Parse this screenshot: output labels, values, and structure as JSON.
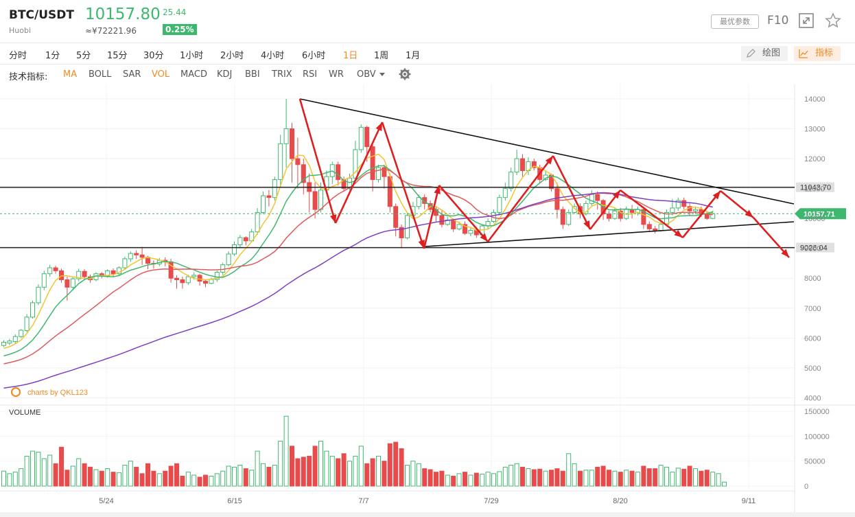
{
  "header": {
    "pair": "BTC/USDT",
    "exchange": "Huobi",
    "price": "10157.80",
    "change": "25.44",
    "cny": "≈¥72221.96",
    "change_pct": "0.25%",
    "best_params": "最优参数",
    "f10": "F10",
    "expand_icon": "expand-icon",
    "star_icon": "star-icon"
  },
  "periods": [
    "分时",
    "1分",
    "5分",
    "15分",
    "30分",
    "1小时",
    "2小时",
    "4小时",
    "6小时",
    "1日",
    "1周",
    "1月"
  ],
  "active_period": "1日",
  "tools": {
    "draw": "绘图",
    "indicator": "指标"
  },
  "indicators": {
    "label": "技术指标:",
    "items": [
      "MA",
      "BOLL",
      "SAR",
      "VOL",
      "MACD",
      "KDJ",
      "BBI",
      "TRIX",
      "RSI",
      "WR",
      "OBV"
    ],
    "active": [
      "MA",
      "VOL"
    ]
  },
  "watermark": "charts by QKL123",
  "volume_label": "VOLUME",
  "colors": {
    "up": "#3fb86f",
    "down": "#e84b4b",
    "accent": "#f08a24",
    "ma5": "#f4c430",
    "ma10": "#3fb86f",
    "ma20": "#e05a5a",
    "ma60": "#7b3fc4"
  },
  "chart_data": {
    "type": "candlestick",
    "x_ticks": [
      "5/24",
      "6/15",
      "7/7",
      "7/29",
      "8/20",
      "9/11"
    ],
    "price_ticks": [
      14000,
      13000,
      12000,
      11000,
      10000,
      9000,
      8000,
      7000,
      6000,
      5000,
      4000
    ],
    "volume_ticks": [
      150000,
      100000,
      50000,
      0
    ],
    "ylim": [
      4000,
      14000
    ],
    "labels": {
      "resistance": "11043.70",
      "current": "10157.71",
      "support": "9026.04"
    },
    "levels": {
      "resistance": 11043.7,
      "current": 10157.71,
      "support": 9026.04
    },
    "candles": [
      [
        5750,
        5860,
        5700,
        5930
      ],
      [
        5830,
        5900,
        5760,
        5970
      ],
      [
        5880,
        6050,
        5820,
        6120
      ],
      [
        6050,
        6260,
        6000,
        6300
      ],
      [
        6250,
        6700,
        6200,
        6800
      ],
      [
        6700,
        7180,
        6650,
        7250
      ],
      [
        7180,
        7700,
        7100,
        7800
      ],
      [
        7700,
        8150,
        7600,
        8250
      ],
      [
        8150,
        8350,
        8050,
        8450
      ],
      [
        8350,
        8250,
        8150,
        8420
      ],
      [
        8250,
        7950,
        7850,
        8320
      ],
      [
        7950,
        7700,
        7250,
        8050
      ],
      [
        7700,
        7980,
        7600,
        8060
      ],
      [
        7980,
        8230,
        7900,
        8320
      ],
      [
        8230,
        8050,
        7950,
        8300
      ],
      [
        8050,
        7950,
        7850,
        8130
      ],
      [
        7950,
        8150,
        7900,
        8200
      ],
      [
        8150,
        8080,
        8000,
        8200
      ],
      [
        8080,
        8250,
        8020,
        8300
      ],
      [
        8250,
        8150,
        8050,
        8330
      ],
      [
        8150,
        8350,
        8100,
        8400
      ],
      [
        8350,
        8650,
        8300,
        8720
      ],
      [
        8650,
        8830,
        8550,
        8900
      ],
      [
        8830,
        8780,
        8650,
        8930
      ],
      [
        8780,
        8700,
        8450,
        9050
      ],
      [
        8700,
        8500,
        8300,
        8750
      ],
      [
        8500,
        8480,
        8320,
        8600
      ],
      [
        8480,
        8600,
        8400,
        8680
      ],
      [
        8600,
        8550,
        8400,
        8700
      ],
      [
        8550,
        8000,
        7850,
        8650
      ],
      [
        8000,
        7950,
        7650,
        8100
      ],
      [
        7950,
        7850,
        7650,
        8050
      ],
      [
        7850,
        8050,
        7780,
        8120
      ],
      [
        8050,
        8100,
        7950,
        8200
      ],
      [
        8100,
        7900,
        7750,
        8150
      ],
      [
        7900,
        7830,
        7700,
        7950
      ],
      [
        7830,
        7960,
        7800,
        8020
      ],
      [
        7960,
        8200,
        7880,
        8260
      ],
      [
        8200,
        8450,
        8100,
        8520
      ],
      [
        8450,
        8810,
        8400,
        8900
      ],
      [
        8810,
        9120,
        8750,
        9230
      ],
      [
        9120,
        9360,
        9000,
        9450
      ],
      [
        9360,
        9250,
        9100,
        9400
      ],
      [
        9250,
        9550,
        9200,
        9650
      ],
      [
        9550,
        10200,
        9450,
        10350
      ],
      [
        10200,
        10760,
        10150,
        10900
      ],
      [
        10760,
        10700,
        10400,
        10950
      ],
      [
        10700,
        11300,
        10600,
        11400
      ],
      [
        11300,
        12500,
        11100,
        12800
      ],
      [
        12500,
        13000,
        11700,
        14000
      ],
      [
        13000,
        12000,
        11200,
        13200
      ],
      [
        12000,
        11800,
        11000,
        12700
      ],
      [
        11800,
        11200,
        10800,
        12000
      ],
      [
        11200,
        10900,
        10200,
        11500
      ],
      [
        10900,
        10300,
        10000,
        11200
      ],
      [
        10300,
        10950,
        10200,
        11200
      ],
      [
        10950,
        11400,
        10800,
        11600
      ],
      [
        11400,
        11800,
        11150,
        11900
      ],
      [
        11800,
        11300,
        11100,
        11900
      ],
      [
        11300,
        11000,
        10900,
        11400
      ],
      [
        11000,
        11350,
        10950,
        11500
      ],
      [
        11350,
        12300,
        11300,
        12600
      ],
      [
        12300,
        13050,
        12200,
        13150
      ],
      [
        13050,
        12400,
        11900,
        13100
      ],
      [
        12400,
        11300,
        10900,
        12500
      ],
      [
        11300,
        11700,
        11200,
        11800
      ],
      [
        11700,
        11400,
        11000,
        11800
      ],
      [
        11400,
        10400,
        10200,
        11500
      ],
      [
        10400,
        9700,
        9400,
        10500
      ],
      [
        9700,
        9350,
        9000,
        9800
      ],
      [
        9350,
        10100,
        9300,
        10200
      ],
      [
        10100,
        10400,
        10000,
        10550
      ],
      [
        10400,
        10700,
        10300,
        10800
      ],
      [
        10700,
        10500,
        10300,
        10800
      ],
      [
        10500,
        10300,
        10200,
        10600
      ],
      [
        10300,
        10100,
        9900,
        10400
      ],
      [
        10100,
        9800,
        9700,
        10300
      ],
      [
        9800,
        9950,
        9750,
        10050
      ],
      [
        9950,
        9650,
        9550,
        10000
      ],
      [
        9650,
        9800,
        9600,
        9900
      ],
      [
        9800,
        9500,
        9450,
        9900
      ],
      [
        9500,
        9600,
        9400,
        9700
      ],
      [
        9600,
        9450,
        9350,
        9700
      ],
      [
        9450,
        9750,
        9400,
        9800
      ],
      [
        9750,
        9900,
        9650,
        10000
      ],
      [
        9900,
        10200,
        9850,
        10300
      ],
      [
        10200,
        10700,
        10100,
        10800
      ],
      [
        10700,
        11000,
        10600,
        11200
      ],
      [
        11000,
        11550,
        10900,
        11700
      ],
      [
        11550,
        12000,
        11450,
        12300
      ],
      [
        12000,
        11600,
        11400,
        12150
      ],
      [
        11600,
        11900,
        11450,
        12050
      ],
      [
        11900,
        11700,
        11600,
        12000
      ],
      [
        11700,
        11300,
        11200,
        11800
      ],
      [
        11300,
        11450,
        11250,
        11600
      ],
      [
        11450,
        11000,
        10900,
        11500
      ],
      [
        11000,
        10300,
        10000,
        11200
      ],
      [
        10300,
        9800,
        9650,
        10400
      ],
      [
        9800,
        10200,
        9750,
        10300
      ],
      [
        10200,
        10400,
        10150,
        10500
      ],
      [
        10400,
        10150,
        10000,
        10500
      ],
      [
        10150,
        10500,
        10100,
        10600
      ],
      [
        10500,
        10800,
        10400,
        10950
      ],
      [
        10800,
        10600,
        10300,
        10900
      ],
      [
        10600,
        10150,
        9950,
        10650
      ],
      [
        10150,
        10000,
        9900,
        10250
      ],
      [
        10000,
        10250,
        9950,
        10350
      ],
      [
        10250,
        10000,
        9900,
        10350
      ],
      [
        10000,
        10300,
        9950,
        10400
      ],
      [
        10300,
        10200,
        10000,
        10450
      ],
      [
        10200,
        10300,
        10100,
        10400
      ],
      [
        10300,
        9800,
        9650,
        10350
      ],
      [
        9800,
        9650,
        9550,
        9900
      ],
      [
        9650,
        9600,
        9500,
        9750
      ],
      [
        9600,
        9800,
        9550,
        9900
      ],
      [
        9800,
        10200,
        9750,
        10300
      ],
      [
        10200,
        10350,
        10100,
        10650
      ],
      [
        10350,
        10600,
        10250,
        10700
      ],
      [
        10600,
        10400,
        10300,
        10700
      ],
      [
        10400,
        10250,
        10100,
        10500
      ],
      [
        10250,
        10300,
        10150,
        10400
      ],
      [
        10300,
        10150,
        10050,
        10400
      ],
      [
        10150,
        10000,
        9950,
        10250
      ],
      [
        10000,
        10160,
        9980,
        10250
      ]
    ],
    "volume": [
      30000,
      25000,
      28000,
      35000,
      60000,
      70000,
      68000,
      55000,
      62000,
      45000,
      78000,
      32000,
      40000,
      55000,
      45000,
      38000,
      33000,
      30000,
      35000,
      28000,
      27000,
      42000,
      50000,
      38000,
      25000,
      45000,
      30000,
      25000,
      30000,
      40000,
      45000,
      20000,
      28000,
      22000,
      18000,
      22000,
      20000,
      25000,
      30000,
      40000,
      38000,
      42000,
      35000,
      32000,
      70000,
      45000,
      38000,
      42000,
      90000,
      140000,
      80000,
      55000,
      58000,
      60000,
      80000,
      90000,
      70000,
      60000,
      55000,
      65000,
      50000,
      60000,
      80000,
      45000,
      55000,
      60000,
      50000,
      85000,
      88000,
      75000,
      42000,
      50000,
      45000,
      35000,
      33000,
      28000,
      30000,
      22000,
      20000,
      25000,
      28000,
      22000,
      26000,
      24000,
      28000,
      25000,
      29000,
      38000,
      42000,
      45000,
      38000,
      35000,
      33000,
      34000,
      30000,
      32000,
      35000,
      30000,
      65000,
      45000,
      30000,
      32000,
      32000,
      38000,
      40000,
      32000,
      30000,
      28000,
      32000,
      30000,
      28000,
      40000,
      35000,
      35000,
      42000,
      38000,
      28000,
      36000,
      34000,
      40000,
      35000,
      30000,
      32000,
      28000,
      25000,
      8000
    ],
    "patterns": {
      "triangle_upper": [
        [
          437,
          144
        ],
        [
          1157,
          297
        ]
      ],
      "triangle_lower": [
        [
          620,
          359
        ],
        [
          1157,
          323
        ]
      ],
      "zigzag": [
        [
          437,
          144
        ],
        [
          489,
          325
        ],
        [
          557,
          178
        ],
        [
          618,
          362
        ],
        [
          640,
          270
        ],
        [
          711,
          352
        ],
        [
          806,
          227
        ],
        [
          860,
          334
        ],
        [
          904,
          277
        ],
        [
          995,
          346
        ],
        [
          1050,
          278
        ],
        [
          1098,
          317
        ],
        [
          1150,
          375
        ]
      ]
    }
  }
}
